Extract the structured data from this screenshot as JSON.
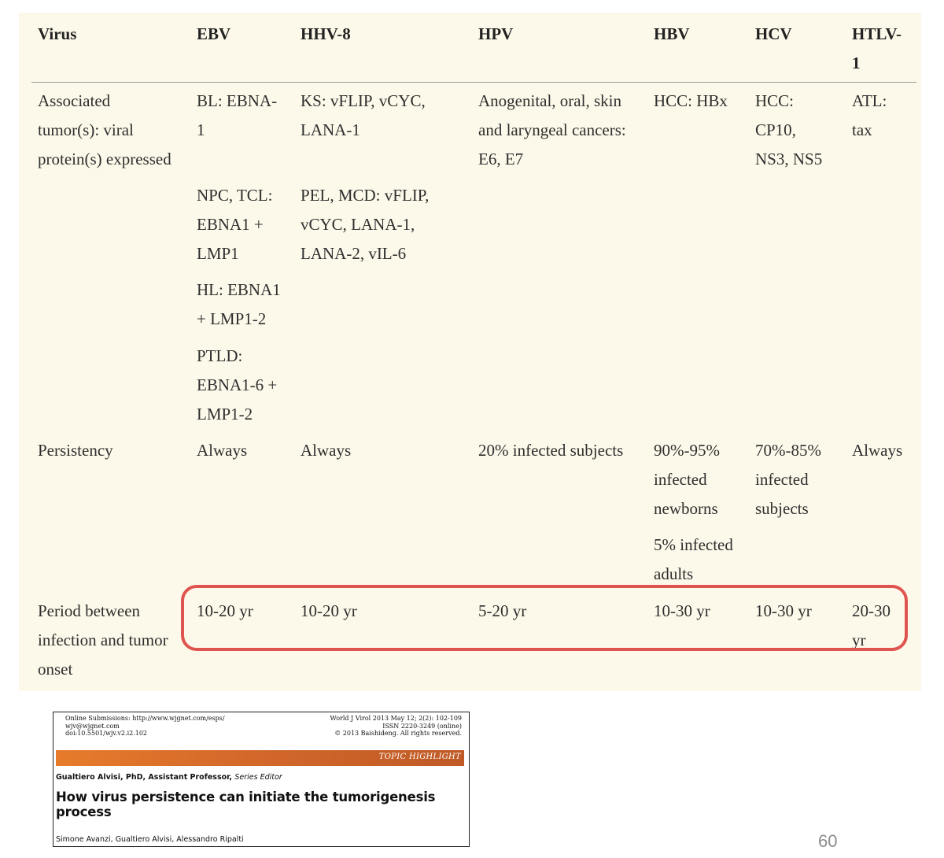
{
  "table": {
    "headers": [
      "Virus",
      "EBV",
      "HHV-8",
      "HPV",
      "HBV",
      "HCV",
      "HTLV-\n1"
    ],
    "rows": [
      {
        "label": "Associated\ntumor(s): viral\nprotein(s) expressed",
        "cells": [
          [
            "BL: EBNA-\n1",
            "NPC, TCL:\nEBNA1 +\nLMP1",
            "HL: EBNA1\n+ LMP1-2",
            "PTLD:\nEBNA1-6 +\nLMP1-2"
          ],
          [
            "KS: vFLIP, vCYC,\nLANA-1",
            "PEL, MCD: vFLIP,\nvCYC, LANA-1,\nLANA-2, vIL-6"
          ],
          [
            "Anogenital, oral, skin\nand laryngeal cancers:\nE6, E7"
          ],
          [
            "HCC: HBx"
          ],
          [
            "HCC:\nCP10,\nNS3, NS5"
          ],
          [
            "ATL:\ntax"
          ]
        ]
      },
      {
        "label": "Persistency",
        "cells": [
          [
            "Always"
          ],
          [
            "Always"
          ],
          [
            "20% infected subjects"
          ],
          [
            "90%-95%\ninfected\nnewborns",
            "5% infected\nadults"
          ],
          [
            "70%-85%\ninfected\nsubjects"
          ],
          [
            "Always"
          ]
        ]
      },
      {
        "label": "Period between\ninfection and tumor\nonset",
        "cells": [
          [
            "10-20 yr"
          ],
          [
            "10-20 yr"
          ],
          [
            "5-20 yr"
          ],
          [
            "10-30 yr"
          ],
          [
            "10-30 yr"
          ],
          [
            "20-30\nyr"
          ]
        ]
      }
    ],
    "highlight_color": "#e0544f",
    "background_color": "#fdf9ea"
  },
  "article": {
    "header_left": "Online Submissions: http://www.wjgnet.com/esps/\nwjv@wjgnet.com\ndoi:10.5501/wjv.v2.i2.102",
    "header_right": "World J Virol  2013 May 12; 2(2): 102-109\nISSN 2220-3249 (online)\n© 2013 Baishideng. All rights reserved.",
    "topic": "TOPIC HIGHLIGHT",
    "editor_name": "Gualtiero Alvisi, PhD, Assistant Professor,",
    "editor_role": "Series Editor",
    "title": "How virus persistence can initiate the tumorigenesis process",
    "authors": "Simone Avanzi, Gualtiero Alvisi, Alessandro Ripalti",
    "accent_color": "#e07a2c"
  },
  "page_number": "60"
}
